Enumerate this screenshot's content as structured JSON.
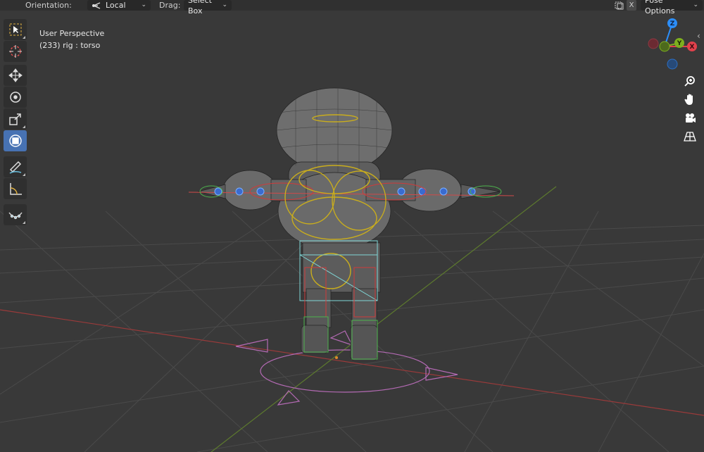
{
  "header": {
    "orientation_label": "Orientation:",
    "orientation_value": "Local",
    "drag_label": "Drag:",
    "drag_value": "Select Box",
    "x_label": "X",
    "pose_options_label": "Pose Options"
  },
  "viewport": {
    "title": "User Perspective",
    "subtitle": "(233) rig : torso"
  },
  "gizmo": {
    "z_label": "Z",
    "y_label": "Y",
    "x_label": "X",
    "colors": {
      "x": "#e2414c",
      "y": "#7eaf1f",
      "z": "#2c8ef8"
    }
  },
  "tools": [
    {
      "name": "select-box-tool",
      "icon": "select-box-icon",
      "active": false
    },
    {
      "name": "cursor-tool",
      "icon": "cursor-icon",
      "active": false
    },
    {
      "name": "move-tool",
      "icon": "move-icon",
      "active": false
    },
    {
      "name": "rotate-tool",
      "icon": "rotate-icon",
      "active": false
    },
    {
      "name": "scale-tool",
      "icon": "scale-icon",
      "active": false
    },
    {
      "name": "transform-tool",
      "icon": "transform-icon",
      "active": true
    },
    {
      "name": "annotate-tool",
      "icon": "annotate-icon",
      "active": false
    },
    {
      "name": "measure-tool",
      "icon": "measure-icon",
      "active": false
    },
    {
      "name": "relax-tool",
      "icon": "curve-icon",
      "active": false
    }
  ],
  "nav_icons": [
    "zoom-icon",
    "hand-pan-icon",
    "camera-icon",
    "grid-perspective-icon"
  ]
}
